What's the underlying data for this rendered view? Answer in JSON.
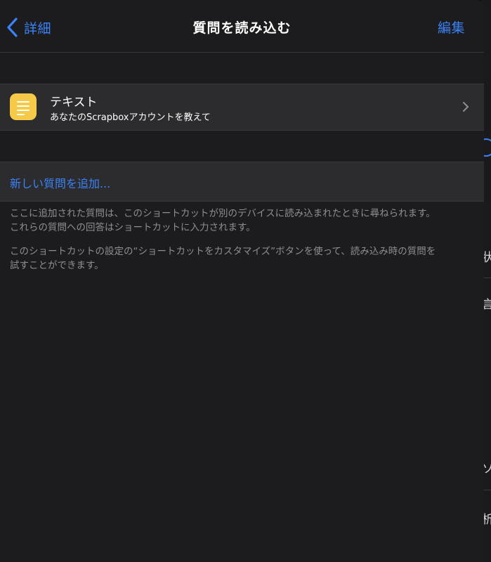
{
  "colors": {
    "accent": "#3a82f6",
    "background": "#1c1c1e",
    "cell": "#2c2c2e",
    "icon": "#f7c948",
    "secondary_text": "#8e8e93"
  },
  "navbar": {
    "back_label": "詳細",
    "title": "質問を読み込む",
    "edit_label": "編集"
  },
  "questions": [
    {
      "icon": "text-lines-icon",
      "title": "テキスト",
      "subtitle": "あなたのScrapboxアカウントを教えて"
    }
  ],
  "add_question_label": "新しい質問を追加...",
  "footer": {
    "line1": "ここに追加された質問は、このショートカットが別のデバイスに読み込まれたときに尋ねられます。",
    "line2": "これらの質問への回答はショートカットに入力されます。",
    "line3": "このショートカットの設定の“ショートカットをカスタマイズ”ボタンを使って、読み込み時の質問を",
    "line4": "試すことができます。"
  },
  "background_glyphs": [
    "状",
    "言",
    "ソ",
    "析"
  ]
}
